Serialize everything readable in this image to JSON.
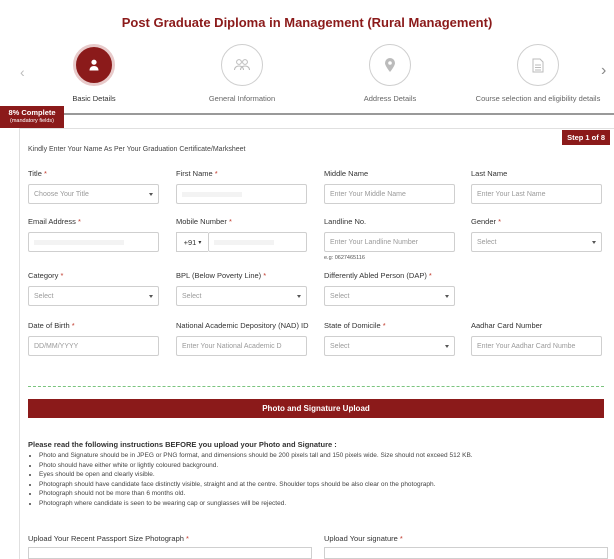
{
  "header": {
    "title": "Post Graduate Diploma in Management (Rural Management)"
  },
  "steps": [
    {
      "label": "Basic Details",
      "icon": "user-icon",
      "active": true
    },
    {
      "label": "General Information",
      "icon": "users-icon",
      "active": false
    },
    {
      "label": "Address Details",
      "icon": "location-icon",
      "active": false
    },
    {
      "label": "Course selection and eligibility details",
      "icon": "document-icon",
      "active": false
    }
  ],
  "progress": {
    "percent": 8,
    "label": "8% Complete",
    "sublabel": "(mandatory fields)"
  },
  "step_tag": "Step 1 of 8",
  "instruction": "Kindly Enter Your Name As Per Your Graduation Certificate/Marksheet",
  "fields": {
    "title": {
      "label": "Title",
      "placeholder": "Choose Your Title"
    },
    "first_name": {
      "label": "First Name"
    },
    "middle_name": {
      "label": "Middle Name",
      "placeholder": "Enter Your Middle Name"
    },
    "last_name": {
      "label": "Last Name",
      "placeholder": "Enter Your Last Name"
    },
    "email": {
      "label": "Email Address"
    },
    "mobile": {
      "label": "Mobile Number",
      "code": "+91"
    },
    "landline": {
      "label": "Landline No.",
      "placeholder": "Enter Your Landline Number",
      "hint": "e.g: 0627465116"
    },
    "gender": {
      "label": "Gender",
      "placeholder": "Select"
    },
    "category": {
      "label": "Category",
      "placeholder": "Select"
    },
    "bpl": {
      "label": "BPL (Below Poverty Line)",
      "placeholder": "Select"
    },
    "dap": {
      "label": "Differently Abled Person (DAP)",
      "placeholder": "Select"
    },
    "dob": {
      "label": "Date of Birth",
      "placeholder": "DD/MM/YYYY"
    },
    "nad": {
      "label": "National Academic Depository (NAD) ID",
      "placeholder": "Enter Your National Academic D"
    },
    "domicile": {
      "label": "State of Domicile",
      "placeholder": "Select"
    },
    "aadhar": {
      "label": "Aadhar Card Number",
      "placeholder": "Enter Your Aadhar Card Numbe"
    }
  },
  "photo_section": {
    "banner": "Photo and Signature Upload",
    "heading": "Please read the following instructions BEFORE you upload your Photo and Signature :",
    "instructions": [
      "Photo and Signature should be in JPEG or PNG format, and dimensions should be 200 pixels tall and 150 pixels wide. Size should not exceed 512 KB.",
      "Photo should have either white or lightly coloured background.",
      "Eyes should be open and clearly visible.",
      "Photograph should have candidate face distinctly visible, straight and at the centre. Shoulder tops should be also clear on the photograph.",
      "Photograph should not be more than 6 months old.",
      "Photograph where candidate is seen to be wearing cap or sunglasses will be rejected."
    ],
    "upload_photo_label": "Upload Your Recent Passport Size Photograph",
    "upload_signature_label": "Upload Your signature"
  },
  "colors": {
    "brand": "#8b1a1a",
    "divider": "#7bc47f"
  }
}
